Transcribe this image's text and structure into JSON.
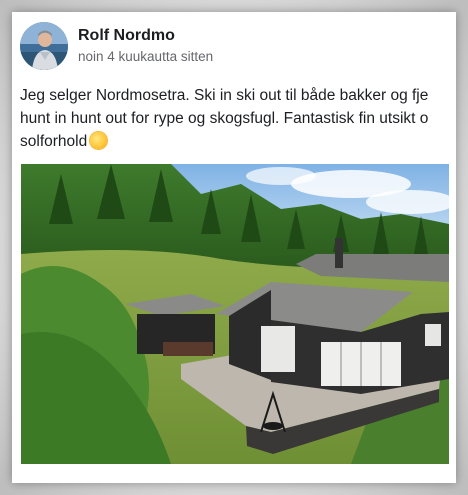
{
  "post": {
    "author_name": "Rolf Nordmo",
    "timestamp": "noin 4 kuukautta sitten",
    "text_lines": [
      "Jeg selger Nordmosetra. Ski in ski out til både bakker og fje",
      "hunt in hunt out for rype og skogsfugl. Fantastisk fin utsikt o",
      "solforhold"
    ],
    "emoji": "sun-emoji"
  },
  "colors": {
    "author_text": "#1c1e21",
    "secondary_text": "#65676b",
    "card_background": "#ffffff",
    "frame_background": "#c9c9c9"
  }
}
